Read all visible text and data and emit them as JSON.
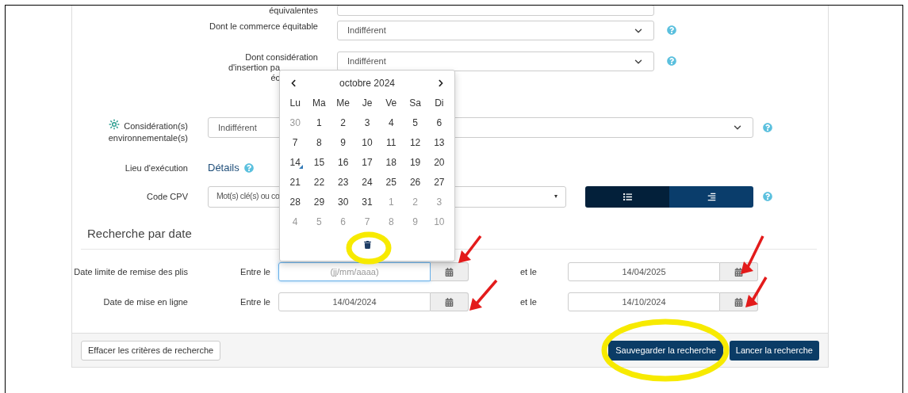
{
  "partial_row": {
    "label": "équivalentes"
  },
  "selects": [
    {
      "label_lines": [
        "Dont le commerce équitable"
      ],
      "value": "Indifférent"
    },
    {
      "label_lines": [
        "Dont considération",
        "d'insertion pa",
        "éc"
      ],
      "value": "Indifférent"
    }
  ],
  "environmental": {
    "label_lines": [
      "Considération(s)",
      "environnementale(s)"
    ],
    "value": "Indifférent"
  },
  "location": {
    "label": "Lieu d'exécution",
    "link": "Détails"
  },
  "cpv": {
    "label": "Code CPV",
    "value": "Mot(s) clé(s) ou co",
    "caret": "▾",
    "views": [
      {
        "selected": true
      },
      {
        "selected": false
      }
    ]
  },
  "date_section": {
    "heading": "Recherche par date",
    "rows": [
      {
        "label": "Date limite de remise des plis",
        "from_label": "Entre le",
        "from": {
          "placeholder": "(jj/mm/aaaa)",
          "focused": true
        },
        "to_label": "et le",
        "to": {
          "value": "14/04/2025",
          "focused": false
        }
      },
      {
        "label": "Date de mise en ligne",
        "from_label": "Entre le",
        "from": {
          "value": "14/04/2024",
          "focused": false
        },
        "to_label": "et le",
        "to": {
          "value": "14/10/2024",
          "focused": false
        }
      }
    ]
  },
  "footer": {
    "clear_button": "Effacer les critères de recherche",
    "save_button": "Sauvegarder la recherche",
    "search_button": "Lancer la recherche"
  },
  "calendar": {
    "month": "octobre 2024",
    "weekdays": [
      "Lu",
      "Ma",
      "Me",
      "Je",
      "Ve",
      "Sa",
      "Di"
    ],
    "weeks": [
      [
        {
          "day": "30",
          "muted": true,
          "today": false
        },
        {
          "day": "1",
          "muted": false,
          "today": false
        },
        {
          "day": "2",
          "muted": false,
          "today": false
        },
        {
          "day": "3",
          "muted": false,
          "today": false
        },
        {
          "day": "4",
          "muted": false,
          "today": false
        },
        {
          "day": "5",
          "muted": false,
          "today": false
        },
        {
          "day": "6",
          "muted": false,
          "today": false
        }
      ],
      [
        {
          "day": "7",
          "muted": false,
          "today": false
        },
        {
          "day": "8",
          "muted": false,
          "today": false
        },
        {
          "day": "9",
          "muted": false,
          "today": false
        },
        {
          "day": "10",
          "muted": false,
          "today": false
        },
        {
          "day": "11",
          "muted": false,
          "today": false
        },
        {
          "day": "12",
          "muted": false,
          "today": false
        },
        {
          "day": "13",
          "muted": false,
          "today": false
        }
      ],
      [
        {
          "day": "14",
          "muted": false,
          "today": true
        },
        {
          "day": "15",
          "muted": false,
          "today": false
        },
        {
          "day": "16",
          "muted": false,
          "today": false
        },
        {
          "day": "17",
          "muted": false,
          "today": false
        },
        {
          "day": "18",
          "muted": false,
          "today": false
        },
        {
          "day": "19",
          "muted": false,
          "today": false
        },
        {
          "day": "20",
          "muted": false,
          "today": false
        }
      ],
      [
        {
          "day": "21",
          "muted": false,
          "today": false
        },
        {
          "day": "22",
          "muted": false,
          "today": false
        },
        {
          "day": "23",
          "muted": false,
          "today": false
        },
        {
          "day": "24",
          "muted": false,
          "today": false
        },
        {
          "day": "25",
          "muted": false,
          "today": false
        },
        {
          "day": "26",
          "muted": false,
          "today": false
        },
        {
          "day": "27",
          "muted": false,
          "today": false
        }
      ],
      [
        {
          "day": "28",
          "muted": false,
          "today": false
        },
        {
          "day": "29",
          "muted": false,
          "today": false
        },
        {
          "day": "30",
          "muted": false,
          "today": false
        },
        {
          "day": "31",
          "muted": false,
          "today": false
        },
        {
          "day": "1",
          "muted": true,
          "today": false
        },
        {
          "day": "2",
          "muted": true,
          "today": false
        },
        {
          "day": "3",
          "muted": true,
          "today": false
        }
      ],
      [
        {
          "day": "4",
          "muted": true,
          "today": false
        },
        {
          "day": "5",
          "muted": true,
          "today": false
        },
        {
          "day": "6",
          "muted": true,
          "today": false
        },
        {
          "day": "7",
          "muted": true,
          "today": false
        },
        {
          "day": "8",
          "muted": true,
          "today": false
        },
        {
          "day": "9",
          "muted": true,
          "today": false
        },
        {
          "day": "10",
          "muted": true,
          "today": false
        }
      ]
    ]
  },
  "annotations": [
    {
      "kind": "arrow"
    },
    {
      "kind": "arrow"
    },
    {
      "kind": "arrow"
    },
    {
      "kind": "arrow"
    },
    {
      "kind": "highlight"
    },
    {
      "kind": "highlight"
    }
  ]
}
